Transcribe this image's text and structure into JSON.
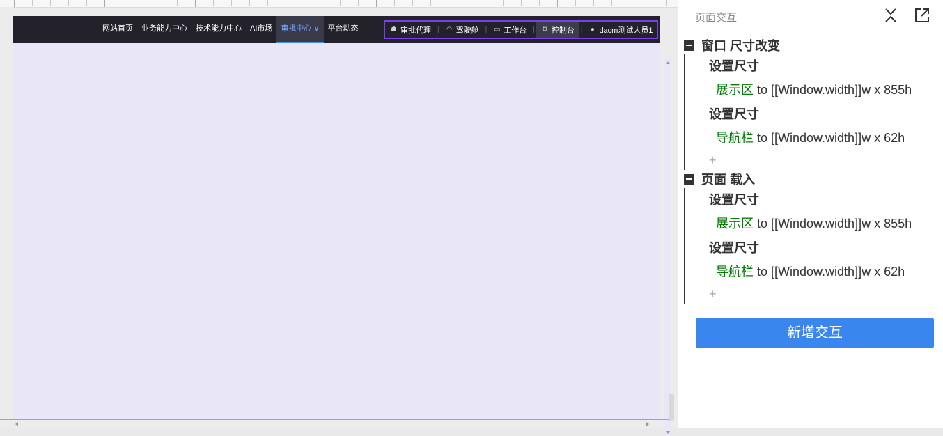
{
  "nav": {
    "links": [
      "网站首页",
      "业务能力中心",
      "技术能力中心",
      "AI市场",
      "审批中心 ∨",
      "平台动态"
    ],
    "right_items": [
      "审批代理",
      "驾驶舱",
      "工作台",
      "控制台",
      "dacm测试人员1"
    ]
  },
  "panel": {
    "title": "页面交互",
    "events": [
      {
        "label": "窗口 尺寸改变",
        "actions": [
          {
            "action": "设置尺寸",
            "target": "展示区",
            "rest": " to [[Window.width]]w x 855h"
          },
          {
            "action": "设置尺寸",
            "target": "导航栏",
            "rest": " to [[Window.width]]w x 62h"
          }
        ],
        "plus": "+"
      },
      {
        "label": "页面 载入",
        "actions": [
          {
            "action": "设置尺寸",
            "target": "展示区",
            "rest": " to [[Window.width]]w x 855h"
          },
          {
            "action": "设置尺寸",
            "target": "导航栏",
            "rest": " to [[Window.width]]w x 62h"
          }
        ],
        "plus": "+"
      }
    ],
    "add_button": "新增交互"
  },
  "colors": {
    "accent": "#3a86ef",
    "target_green": "#008000",
    "nav_bg": "#23222b",
    "highlight_border": "#7b3ff2",
    "canvas_bg": "#e8e6f7"
  }
}
